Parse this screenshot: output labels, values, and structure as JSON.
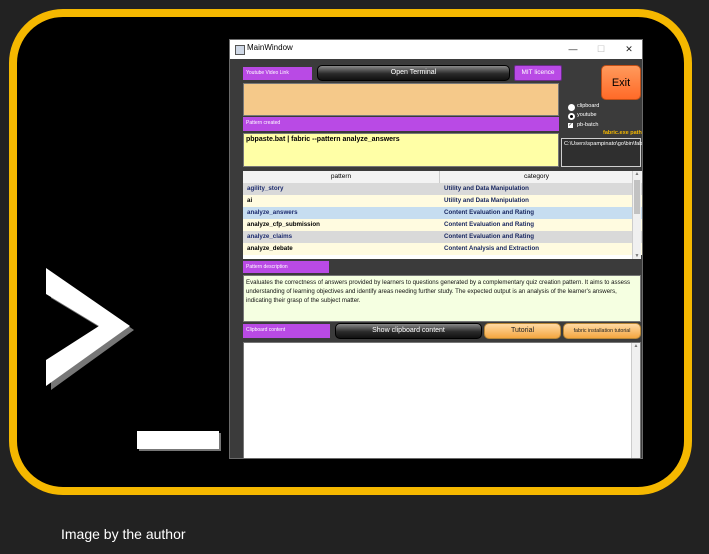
{
  "window": {
    "title": "MainWindow",
    "minimize": "—",
    "maximize": "☐",
    "close": "✕"
  },
  "buttons": {
    "youtube_link": "Youtube Video Link",
    "open_terminal": "Open Terminal",
    "mit_licence": "MIT licence",
    "exit": "Exit",
    "show_clipboard": "Show clipboard content",
    "tutorial": "Tutorial",
    "fabric_tutorial": "fabric installation tutorial"
  },
  "labels": {
    "pattern_created": "Pattern created",
    "pattern_description": "Pattern description",
    "clipboard_content": "Clipboard content",
    "fabric_path": "fabric.exe path"
  },
  "options": {
    "clipboard": "clipboard",
    "youtube": "youtube",
    "pb_batch": "pb-batch",
    "selected": "youtube",
    "pb_batch_checked": true
  },
  "command": "pbpaste.bat | fabric --pattern analyze_answers",
  "fabric_path_value": "C:\\Users\\spampinato\\go\\bin\\fabric.exe",
  "table": {
    "columns": [
      "pattern",
      "category"
    ],
    "rows": [
      {
        "pattern": "agility_story",
        "category": "Utility and Data Manipulation"
      },
      {
        "pattern": "ai",
        "category": "Utility and Data Manipulation"
      },
      {
        "pattern": "analyze_answers",
        "category": "Content Evaluation and Rating"
      },
      {
        "pattern": "analyze_cfp_submission",
        "category": "Content Evaluation and Rating"
      },
      {
        "pattern": "analyze_claims",
        "category": "Content Evaluation and Rating"
      },
      {
        "pattern": "analyze_debate",
        "category": "Content Analysis and Extraction"
      }
    ]
  },
  "description": "Evaluates the correctness of answers provided by learners to questions generated by a complementary quiz creation pattern. It aims to assess understanding of learning objectives and identify areas needing further study. The expected output is an analysis of the learner's answers, indicating their grasp of the subject matter.",
  "caption": "Image by the author",
  "colors": {
    "frame": "#f5b800",
    "tag_purple": "#b94ae5",
    "exit_orange": "#ff7b3a",
    "selected_row": "#c6ddf0"
  }
}
